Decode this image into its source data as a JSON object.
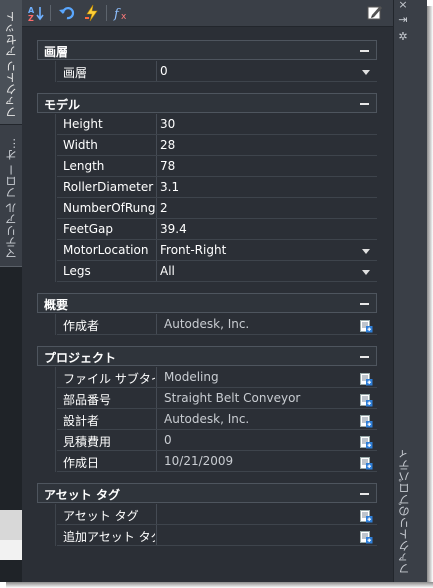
{
  "left_tabs": [
    "ファクトリ アセット",
    "マテリアル フロー オ..."
  ],
  "right_strip": {
    "close": "×",
    "pin": "⇥",
    "gear": "✲",
    "label": "ファクトリのプロパティ"
  },
  "toolbar": {
    "icons": [
      "sort-az-icon",
      "undo-icon",
      "fast-update-icon",
      "function-icon",
      "edit-icon"
    ]
  },
  "sections": [
    {
      "title": "画層",
      "rows": [
        {
          "name": "画層",
          "value": "0",
          "control": "dropdown"
        }
      ]
    },
    {
      "title": "モデル",
      "rows": [
        {
          "name": "Height",
          "value": "30"
        },
        {
          "name": "Width",
          "value": "28"
        },
        {
          "name": "Length",
          "value": "78"
        },
        {
          "name": "RollerDiameter",
          "value": "3.1"
        },
        {
          "name": "NumberOfRung",
          "value": "2"
        },
        {
          "name": "FeetGap",
          "value": "39.4"
        },
        {
          "name": "MotorLocation",
          "value": "Front-Right",
          "control": "dropdown"
        },
        {
          "name": "Legs",
          "value": "All",
          "control": "dropdown"
        }
      ]
    },
    {
      "title": "概要",
      "rows": [
        {
          "name": "作成者",
          "value": "Autodesk, Inc.",
          "control": "props"
        }
      ]
    },
    {
      "title": "プロジェクト",
      "rows": [
        {
          "name": "ファイル サブタイ",
          "value": "Modeling",
          "control": "props"
        },
        {
          "name": "部品番号",
          "value": "Straight Belt Conveyor",
          "control": "props"
        },
        {
          "name": "設計者",
          "value": "Autodesk, Inc.",
          "control": "props"
        },
        {
          "name": "見積費用",
          "value": "0",
          "control": "props"
        },
        {
          "name": "作成日",
          "value": "10/21/2009",
          "control": "props"
        }
      ]
    },
    {
      "title": "アセット タグ",
      "rows": [
        {
          "name": "アセット タグ",
          "value": "",
          "control": "props"
        },
        {
          "name": "追加アセット タグ",
          "value": "",
          "control": "props"
        }
      ]
    }
  ]
}
